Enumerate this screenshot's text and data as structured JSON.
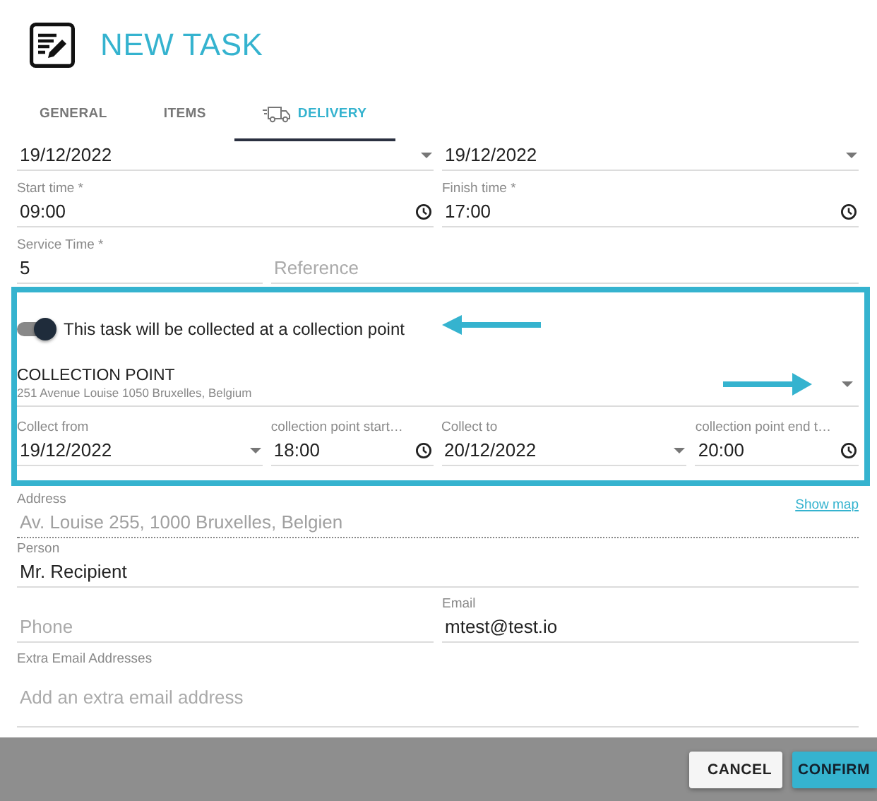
{
  "header": {
    "title": "NEW TASK"
  },
  "tabs": [
    {
      "label": "GENERAL",
      "selected": false,
      "has_icon": false
    },
    {
      "label": "ITEMS",
      "selected": false,
      "has_icon": false
    },
    {
      "label": "DELIVERY",
      "selected": true,
      "has_icon": true
    }
  ],
  "top_rows": [
    {
      "fields": [
        {
          "kind": "date",
          "value": "19/12/2022"
        },
        {
          "kind": "date",
          "value": "19/12/2022"
        }
      ]
    },
    {
      "fields": [
        {
          "kind": "time",
          "label": "Start time *",
          "value": "09:00"
        },
        {
          "kind": "time",
          "label": "Finish time *",
          "value": "17:00"
        }
      ]
    },
    {
      "fields": [
        {
          "kind": "text",
          "label": "Service Time *",
          "value": "5"
        },
        {
          "kind": "text",
          "placeholder": "Reference"
        }
      ]
    }
  ],
  "collection": {
    "toggle": {
      "label": "This task will be collected at a collection point",
      "on": true
    },
    "point": {
      "title": "COLLECTION POINT",
      "address": "251 Avenue Louise 1050 Bruxelles, Belgium"
    },
    "fields": [
      {
        "kind": "date",
        "label": "Collect from",
        "value": "19/12/2022"
      },
      {
        "kind": "time",
        "label": "collection point start…",
        "value": "18:00"
      },
      {
        "kind": "date",
        "label": "Collect to",
        "value": "20/12/2022"
      },
      {
        "kind": "time",
        "label": "collection point end t…",
        "value": "20:00"
      }
    ]
  },
  "address": {
    "label": "Address",
    "value": "Av. Louise 255,  1000 Bruxelles,  Belgien",
    "disabled": true,
    "link": "Show map"
  },
  "bottom_rows": [
    {
      "fields": [
        {
          "kind": "text",
          "label": "Person",
          "value": "Mr. Recipient"
        }
      ]
    },
    {
      "fields": [
        {
          "kind": "text",
          "placeholder": "Phone"
        },
        {
          "kind": "text",
          "label": "Email",
          "value": "mtest@test.io"
        }
      ]
    },
    {
      "fields": [
        {
          "kind": "textarea",
          "label": "Extra Email Addresses",
          "placeholder": "Add an extra email address"
        }
      ]
    }
  ],
  "buttons": [
    {
      "label": "CANCEL",
      "kind": "secondary"
    },
    {
      "label": "CONFIRM",
      "kind": "primary"
    }
  ]
}
